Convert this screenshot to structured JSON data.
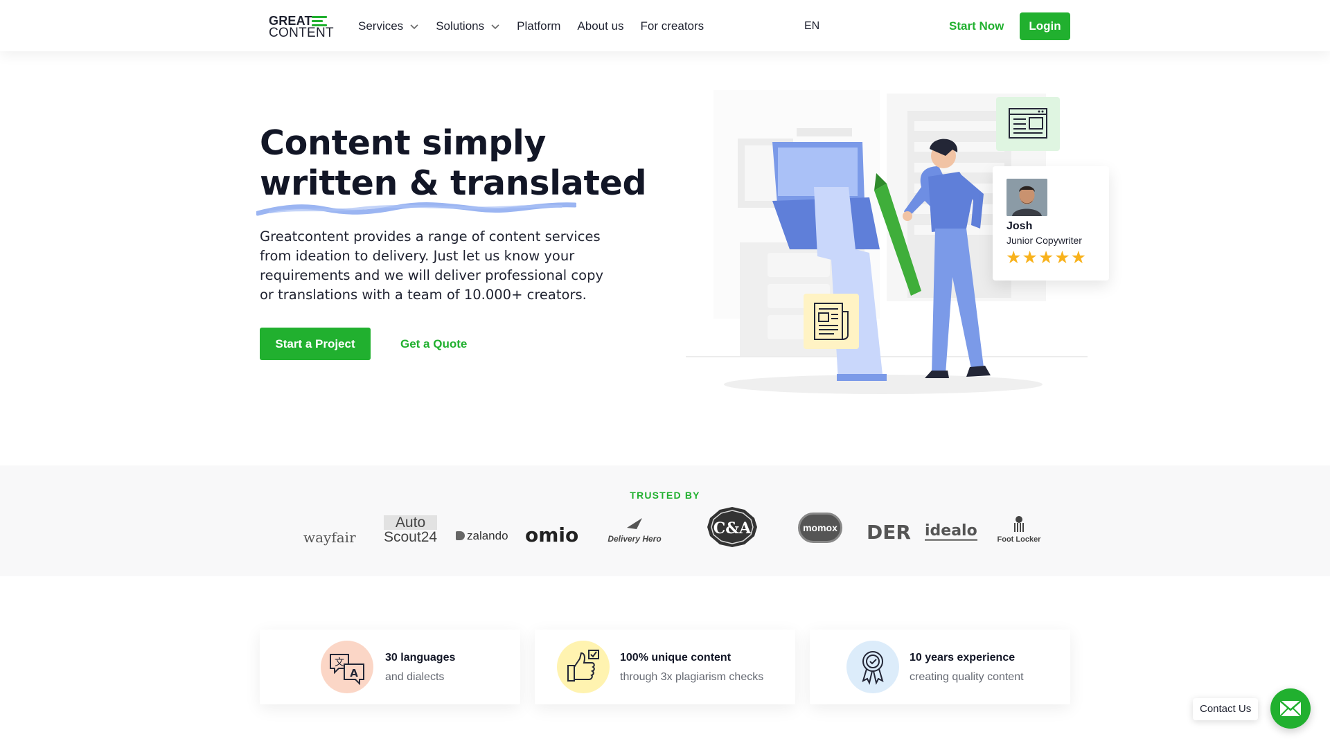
{
  "header": {
    "logo_line1": "GREAT",
    "logo_line2": "CONTENT",
    "nav": [
      {
        "label": "Services",
        "has_dropdown": true
      },
      {
        "label": "Solutions",
        "has_dropdown": true
      },
      {
        "label": "Platform",
        "has_dropdown": false
      },
      {
        "label": "About us",
        "has_dropdown": false
      },
      {
        "label": "For creators",
        "has_dropdown": false
      }
    ],
    "language": "EN",
    "start_now": "Start Now",
    "login": "Login"
  },
  "hero": {
    "title_line1": "Content simply",
    "title_line2": "written & translated",
    "text": "Greatcontent provides a range of content services from ideation to delivery. Just let us know your requirements and we will deliver professional copy or translations with a team of 10.000+ creators.",
    "primary_button": "Start a Project",
    "secondary_button": "Get a Quote"
  },
  "illustration": {
    "card": {
      "name": "Josh",
      "role": "Junior Copywriter",
      "stars": "★★★★★",
      "rating": 5
    }
  },
  "trusted": {
    "label": "TRUSTED BY",
    "brands": [
      {
        "name": "wayfair"
      },
      {
        "name": "Auto Scout24",
        "line1": "Auto",
        "line2": "Scout24"
      },
      {
        "name": "zalando"
      },
      {
        "name": "omio"
      },
      {
        "name": "Delivery Hero"
      },
      {
        "name": "C&A"
      },
      {
        "name": "momox"
      },
      {
        "name": "DER"
      },
      {
        "name": "idealo"
      },
      {
        "name": "Foot Locker"
      }
    ]
  },
  "features": [
    {
      "title": "30 languages",
      "subtitle": "and dialects",
      "icon": "translate-icon",
      "color": "#fbd6c6"
    },
    {
      "title": "100% unique content",
      "subtitle": "through 3x plagiarism checks",
      "icon": "thumbs-up-check-icon",
      "color": "#fff3b0"
    },
    {
      "title": "10 years experience",
      "subtitle": "creating quality content",
      "icon": "award-badge-icon",
      "color": "#dcecfa"
    }
  ],
  "contact": {
    "label": "Contact Us",
    "icon": "mail-icon"
  },
  "colors": {
    "brand_green": "#21b02f",
    "star_yellow": "#f8b21c",
    "text_dark": "#121626",
    "underline_blue": "#8aa8f0"
  }
}
